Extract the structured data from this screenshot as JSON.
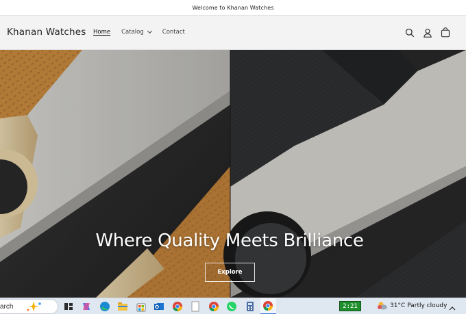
{
  "announcement": {
    "text": "Welcome to Khanan Watches"
  },
  "header": {
    "logo": "Khanan Watches",
    "nav": [
      {
        "label": "Home",
        "active": true
      },
      {
        "label": "Catalog",
        "has_dropdown": true
      },
      {
        "label": "Contact"
      }
    ],
    "icons": [
      "search-icon",
      "account-icon",
      "cart-icon"
    ]
  },
  "hero": {
    "title": "Where Quality Meets Brilliance",
    "button_label": "Explore"
  },
  "taskbar": {
    "search_text": "arch",
    "apps": [
      "task-view-icon",
      "copilot-icon",
      "edge-icon",
      "file-explorer-icon",
      "store-icon",
      "outlook-icon",
      "chrome-icon",
      "notepad-icon",
      "chrome-icon",
      "whatsapp-icon",
      "calculator-icon",
      "chrome-active-icon"
    ],
    "battery_text": "2:21",
    "weather": {
      "temp": "31°C",
      "condition": "Partly cloudy"
    },
    "colors": {
      "accent": "#3a78d8",
      "battery": "#1f8f2c"
    }
  }
}
